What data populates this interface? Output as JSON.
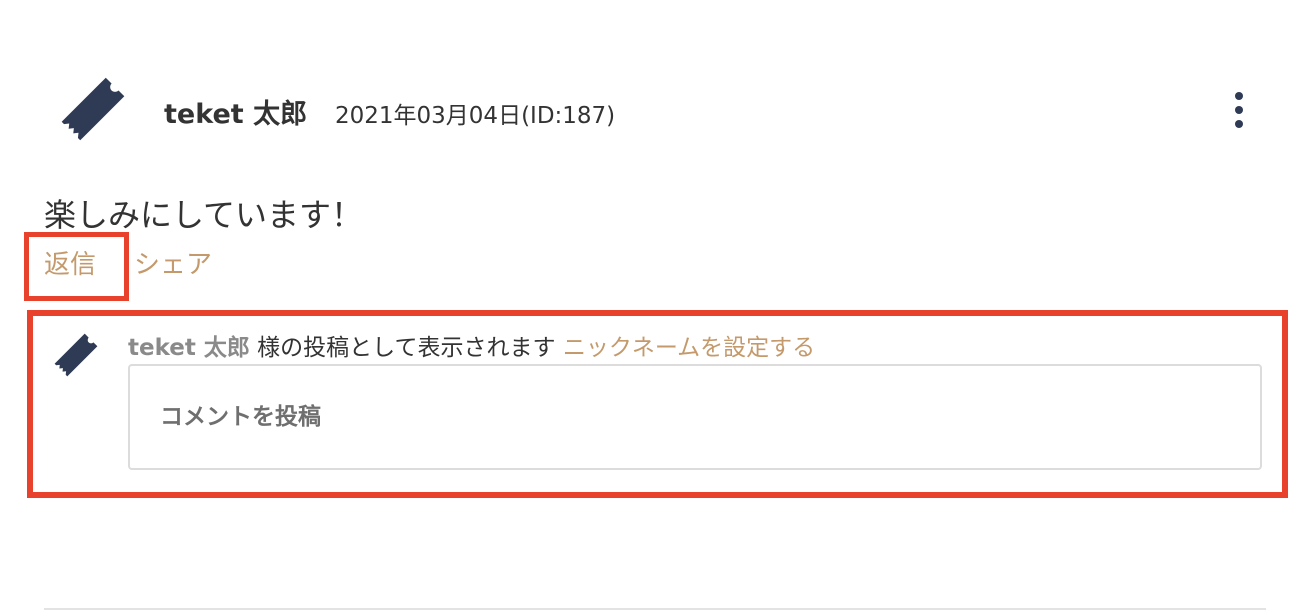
{
  "post": {
    "user_name": "teket 太郎",
    "date": "2021年03月04日(ID:187)",
    "body": "楽しみにしています！",
    "avatar_icon": "ticket-icon",
    "menu_icon": "more-vertical-icon"
  },
  "actions": {
    "reply_label": "返信",
    "share_label": "シェア"
  },
  "reply_form": {
    "poster_name": "teket 太郎",
    "poster_suffix": " 様の投稿として表示されます ",
    "nickname_link": "ニックネームを設定する",
    "placeholder": "コメントを投稿",
    "value": ""
  },
  "colors": {
    "accent": "#c49a6c",
    "icon": "#2f3a55",
    "highlight": "#e8412c",
    "text": "#333333"
  }
}
